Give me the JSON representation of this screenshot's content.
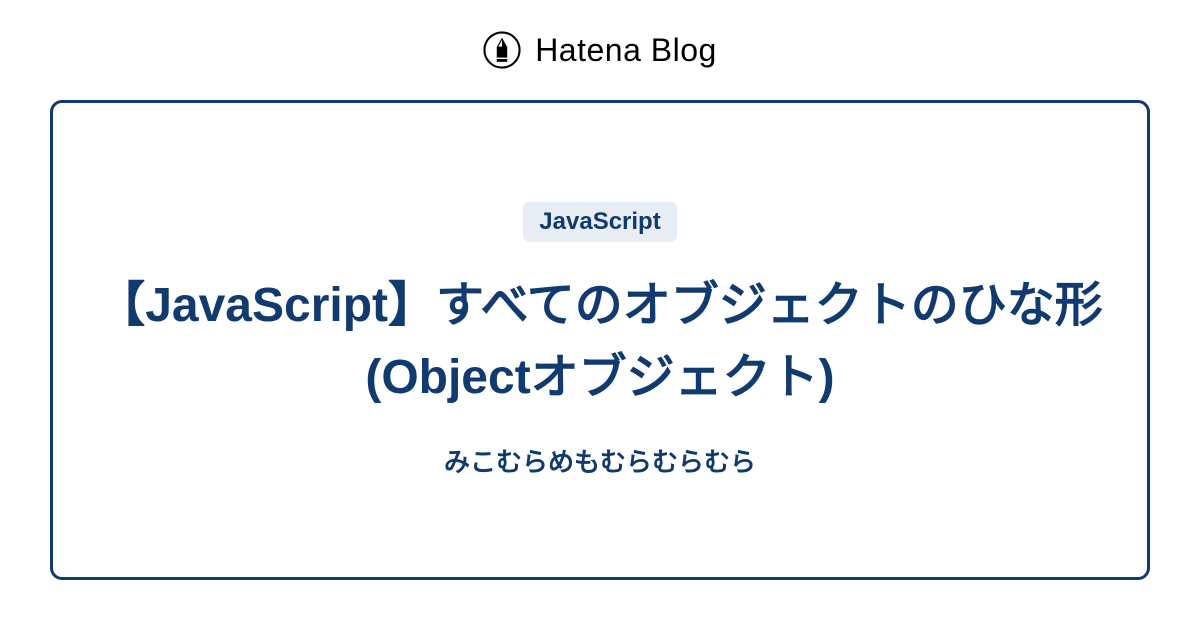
{
  "header": {
    "brand": "Hatena Blog"
  },
  "card": {
    "tag": "JavaScript",
    "title": "【JavaScript】すべてのオブジェクトのひな形 (Objectオブジェクト)",
    "author": "みこむらめもむらむらむら"
  }
}
